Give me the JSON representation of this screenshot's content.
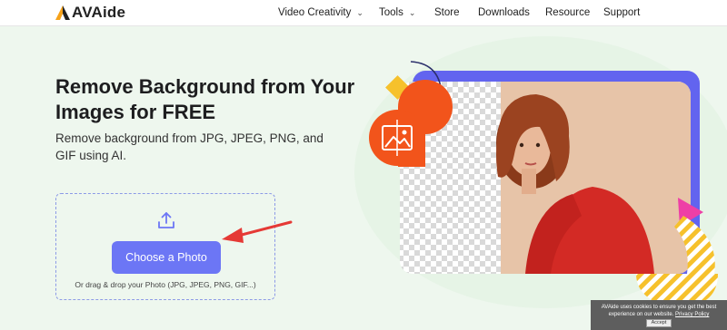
{
  "header": {
    "logo_text": "AVAide",
    "nav": [
      {
        "label": "Video Creativity",
        "has_dropdown": true
      },
      {
        "label": "Tools",
        "has_dropdown": true
      },
      {
        "label": "Store",
        "has_dropdown": false
      },
      {
        "label": "Downloads",
        "has_dropdown": false
      },
      {
        "label": "Resource",
        "has_dropdown": false
      },
      {
        "label": "Support",
        "has_dropdown": false
      }
    ]
  },
  "hero": {
    "title": "Remove Background from Your Images for FREE",
    "subtitle": "Remove background from JPG, JPEG, PNG, and GIF using AI."
  },
  "upload": {
    "button_label": "Choose a Photo",
    "hint": "Or drag & drop your Photo (JPG, JPEG, PNG, GIF...)"
  },
  "cookie_banner": {
    "text": "AVAide uses cookies to ensure you get the best experience on our website.",
    "policy_link": "Privacy Policy",
    "accept_label": "Accept"
  },
  "icons": {
    "upload": "upload-icon",
    "image": "image-icon",
    "chevron": "chevron-down-icon",
    "arrow": "red-arrow-icon"
  },
  "colors": {
    "accent": "#6c76f5",
    "background": "#eef7ee",
    "arrow": "#e53935",
    "image_badge": "#f2541b",
    "decor_yellow": "#f6c12c",
    "decor_pink": "#ee3fa6",
    "frame_purple": "#6264ef"
  }
}
